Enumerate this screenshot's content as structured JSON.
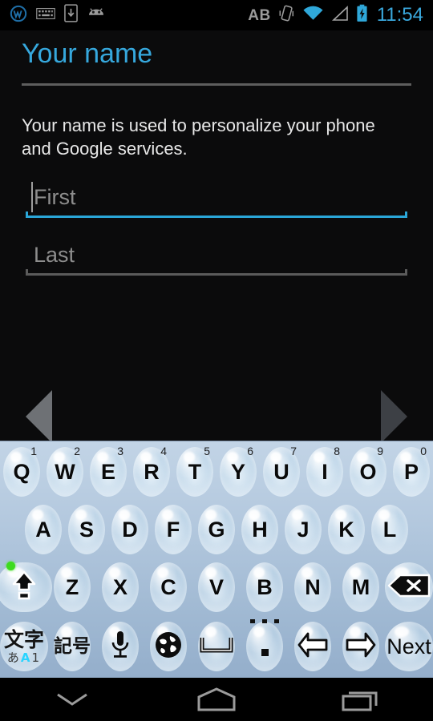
{
  "statusbar": {
    "left_icons": [
      "wikipedia-w-icon",
      "keyboard-icon",
      "download-to-phone-icon",
      "android-robot-icon"
    ],
    "right_icons": [
      "ab-text-icon",
      "vibrate-icon",
      "wifi-icon",
      "signal-triangle-icon",
      "battery-charging-icon"
    ],
    "ab_label": "AB",
    "clock": "11:54",
    "clock_color": "#36a8dd"
  },
  "page": {
    "title": "Your name",
    "title_color": "#36a8dd",
    "description": "Your name is used to personalize your phone and Google services.",
    "fields": [
      {
        "name": "first-name",
        "value": "",
        "placeholder": "First",
        "focused": true
      },
      {
        "name": "last-name",
        "value": "",
        "placeholder": "Last",
        "focused": false
      }
    ],
    "nav": {
      "prev_label": "back-arrow",
      "next_label": "forward-arrow"
    },
    "accent_color": "#2aa6d8"
  },
  "keyboard": {
    "theme": "bubble-blue",
    "row1": [
      {
        "label": "Q",
        "hint": "1"
      },
      {
        "label": "W",
        "hint": "2"
      },
      {
        "label": "E",
        "hint": "3"
      },
      {
        "label": "R",
        "hint": "4"
      },
      {
        "label": "T",
        "hint": "5"
      },
      {
        "label": "Y",
        "hint": "6"
      },
      {
        "label": "U",
        "hint": "7"
      },
      {
        "label": "I",
        "hint": "8"
      },
      {
        "label": "O",
        "hint": "9"
      },
      {
        "label": "P",
        "hint": "0"
      }
    ],
    "row2": [
      {
        "label": "A"
      },
      {
        "label": "S"
      },
      {
        "label": "D"
      },
      {
        "label": "F"
      },
      {
        "label": "G"
      },
      {
        "label": "H"
      },
      {
        "label": "J"
      },
      {
        "label": "K"
      },
      {
        "label": "L"
      }
    ],
    "row3": {
      "shift": {
        "icon": "shift-caps-lock-icon",
        "led_on": true,
        "led_color": "#3ddb1e"
      },
      "letters": [
        {
          "label": "Z"
        },
        {
          "label": "X"
        },
        {
          "label": "C"
        },
        {
          "label": "V"
        },
        {
          "label": "B"
        },
        {
          "label": "N"
        },
        {
          "label": "M"
        }
      ],
      "backspace": {
        "icon": "backspace-icon"
      }
    },
    "row4": {
      "mode": {
        "main": "文字",
        "sub_kana": "あ",
        "sub_alpha": "A",
        "sub_num": "1",
        "active": "A",
        "active_color": "#2ad4ff"
      },
      "symbol": {
        "label": "記号"
      },
      "mic": {
        "icon": "microphone-icon"
      },
      "globe": {
        "icon": "globe-language-icon"
      },
      "space": {
        "icon": "space-bar-icon"
      },
      "period": {
        "label": ".",
        "hints": [
          "dot",
          "dot",
          "dot"
        ]
      },
      "arrow_left": {
        "icon": "arrow-left-icon"
      },
      "arrow_right": {
        "icon": "arrow-right-icon"
      },
      "action": {
        "label": "Next"
      }
    }
  },
  "navbar": {
    "buttons": [
      {
        "name": "hide-keyboard",
        "icon": "chevron-down-icon"
      },
      {
        "name": "home",
        "icon": "home-icon"
      },
      {
        "name": "recents",
        "icon": "recents-icon"
      }
    ]
  }
}
